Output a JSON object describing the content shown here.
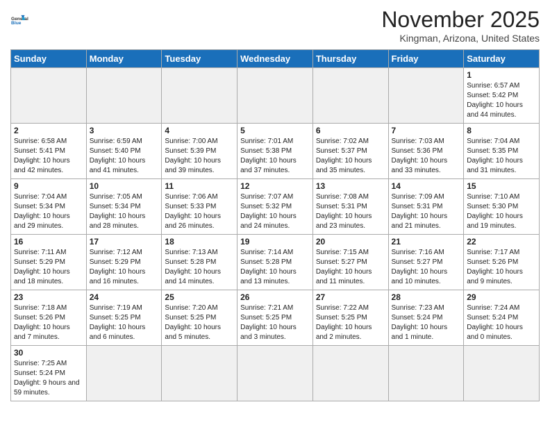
{
  "header": {
    "logo_line1": "General",
    "logo_line2": "Blue",
    "month": "November 2025",
    "location": "Kingman, Arizona, United States"
  },
  "weekdays": [
    "Sunday",
    "Monday",
    "Tuesday",
    "Wednesday",
    "Thursday",
    "Friday",
    "Saturday"
  ],
  "weeks": [
    [
      {
        "day": null,
        "info": ""
      },
      {
        "day": null,
        "info": ""
      },
      {
        "day": null,
        "info": ""
      },
      {
        "day": null,
        "info": ""
      },
      {
        "day": null,
        "info": ""
      },
      {
        "day": null,
        "info": ""
      },
      {
        "day": "1",
        "info": "Sunrise: 6:57 AM\nSunset: 5:42 PM\nDaylight: 10 hours and 44 minutes."
      }
    ],
    [
      {
        "day": "2",
        "info": "Sunrise: 6:58 AM\nSunset: 5:41 PM\nDaylight: 10 hours and 42 minutes."
      },
      {
        "day": "3",
        "info": "Sunrise: 6:59 AM\nSunset: 5:40 PM\nDaylight: 10 hours and 41 minutes."
      },
      {
        "day": "4",
        "info": "Sunrise: 7:00 AM\nSunset: 5:39 PM\nDaylight: 10 hours and 39 minutes."
      },
      {
        "day": "5",
        "info": "Sunrise: 7:01 AM\nSunset: 5:38 PM\nDaylight: 10 hours and 37 minutes."
      },
      {
        "day": "6",
        "info": "Sunrise: 7:02 AM\nSunset: 5:37 PM\nDaylight: 10 hours and 35 minutes."
      },
      {
        "day": "7",
        "info": "Sunrise: 7:03 AM\nSunset: 5:36 PM\nDaylight: 10 hours and 33 minutes."
      },
      {
        "day": "8",
        "info": "Sunrise: 7:04 AM\nSunset: 5:35 PM\nDaylight: 10 hours and 31 minutes."
      }
    ],
    [
      {
        "day": "9",
        "info": "Sunrise: 7:04 AM\nSunset: 5:34 PM\nDaylight: 10 hours and 29 minutes."
      },
      {
        "day": "10",
        "info": "Sunrise: 7:05 AM\nSunset: 5:34 PM\nDaylight: 10 hours and 28 minutes."
      },
      {
        "day": "11",
        "info": "Sunrise: 7:06 AM\nSunset: 5:33 PM\nDaylight: 10 hours and 26 minutes."
      },
      {
        "day": "12",
        "info": "Sunrise: 7:07 AM\nSunset: 5:32 PM\nDaylight: 10 hours and 24 minutes."
      },
      {
        "day": "13",
        "info": "Sunrise: 7:08 AM\nSunset: 5:31 PM\nDaylight: 10 hours and 23 minutes."
      },
      {
        "day": "14",
        "info": "Sunrise: 7:09 AM\nSunset: 5:31 PM\nDaylight: 10 hours and 21 minutes."
      },
      {
        "day": "15",
        "info": "Sunrise: 7:10 AM\nSunset: 5:30 PM\nDaylight: 10 hours and 19 minutes."
      }
    ],
    [
      {
        "day": "16",
        "info": "Sunrise: 7:11 AM\nSunset: 5:29 PM\nDaylight: 10 hours and 18 minutes."
      },
      {
        "day": "17",
        "info": "Sunrise: 7:12 AM\nSunset: 5:29 PM\nDaylight: 10 hours and 16 minutes."
      },
      {
        "day": "18",
        "info": "Sunrise: 7:13 AM\nSunset: 5:28 PM\nDaylight: 10 hours and 14 minutes."
      },
      {
        "day": "19",
        "info": "Sunrise: 7:14 AM\nSunset: 5:28 PM\nDaylight: 10 hours and 13 minutes."
      },
      {
        "day": "20",
        "info": "Sunrise: 7:15 AM\nSunset: 5:27 PM\nDaylight: 10 hours and 11 minutes."
      },
      {
        "day": "21",
        "info": "Sunrise: 7:16 AM\nSunset: 5:27 PM\nDaylight: 10 hours and 10 minutes."
      },
      {
        "day": "22",
        "info": "Sunrise: 7:17 AM\nSunset: 5:26 PM\nDaylight: 10 hours and 9 minutes."
      }
    ],
    [
      {
        "day": "23",
        "info": "Sunrise: 7:18 AM\nSunset: 5:26 PM\nDaylight: 10 hours and 7 minutes."
      },
      {
        "day": "24",
        "info": "Sunrise: 7:19 AM\nSunset: 5:25 PM\nDaylight: 10 hours and 6 minutes."
      },
      {
        "day": "25",
        "info": "Sunrise: 7:20 AM\nSunset: 5:25 PM\nDaylight: 10 hours and 5 minutes."
      },
      {
        "day": "26",
        "info": "Sunrise: 7:21 AM\nSunset: 5:25 PM\nDaylight: 10 hours and 3 minutes."
      },
      {
        "day": "27",
        "info": "Sunrise: 7:22 AM\nSunset: 5:25 PM\nDaylight: 10 hours and 2 minutes."
      },
      {
        "day": "28",
        "info": "Sunrise: 7:23 AM\nSunset: 5:24 PM\nDaylight: 10 hours and 1 minute."
      },
      {
        "day": "29",
        "info": "Sunrise: 7:24 AM\nSunset: 5:24 PM\nDaylight: 10 hours and 0 minutes."
      }
    ],
    [
      {
        "day": "30",
        "info": "Sunrise: 7:25 AM\nSunset: 5:24 PM\nDaylight: 9 hours and 59 minutes."
      },
      {
        "day": null,
        "info": ""
      },
      {
        "day": null,
        "info": ""
      },
      {
        "day": null,
        "info": ""
      },
      {
        "day": null,
        "info": ""
      },
      {
        "day": null,
        "info": ""
      },
      {
        "day": null,
        "info": ""
      }
    ]
  ]
}
